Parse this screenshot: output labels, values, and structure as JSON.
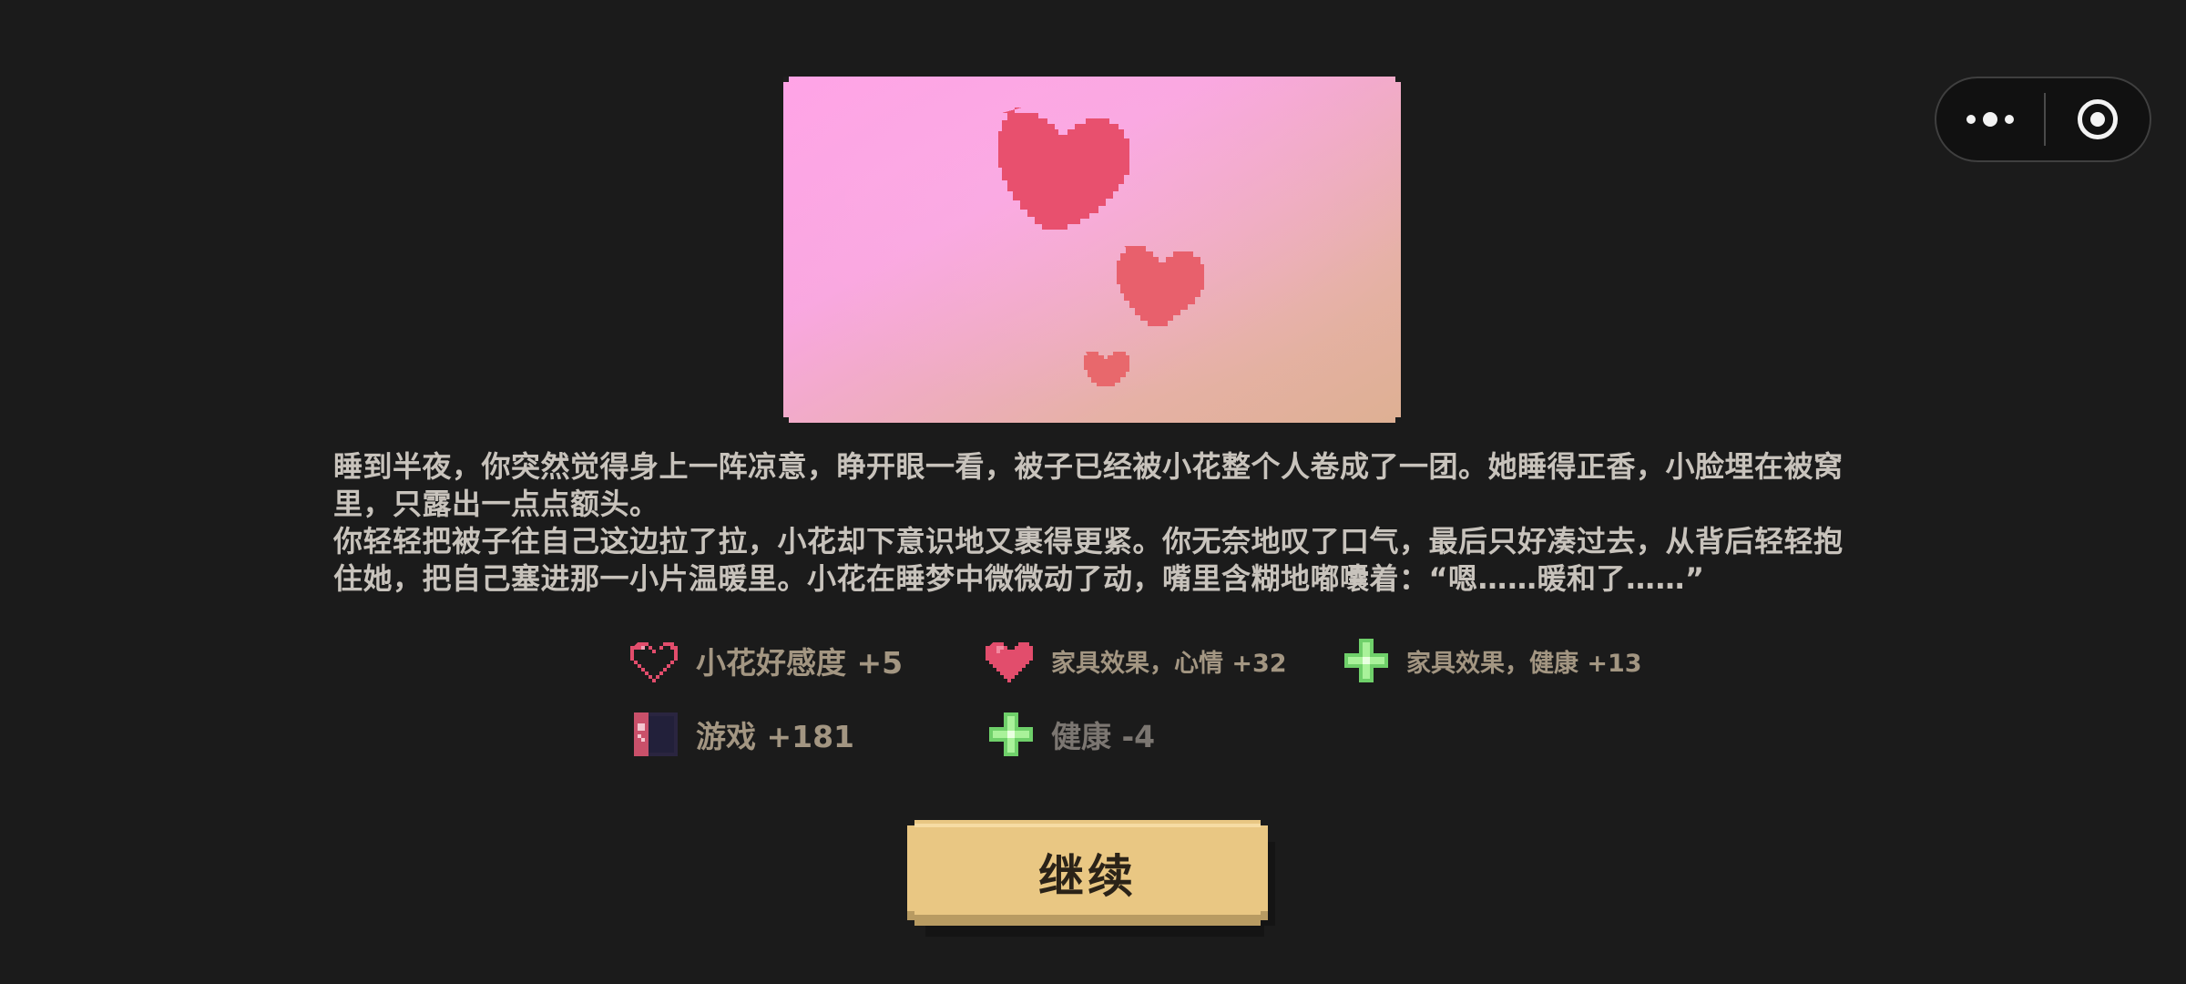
{
  "capsule": {
    "more_icon": "more-dots-icon",
    "close_icon": "target-close-icon"
  },
  "illustration": {
    "icon": "floating-hearts-illustration",
    "colors": {
      "bg_top": "#ffa3e6",
      "bg_bottom": "#dfb197",
      "heart": "#e8506e"
    }
  },
  "story": {
    "paragraph1": "睡到半夜，你突然觉得身上一阵凉意，睁开眼一看，被子已经被小花整个人卷成了一团。她睡得正香，小脸埋在被窝里，只露出一点点额头。",
    "paragraph2": "你轻轻把被子往自己这边拉了拉，小花却下意识地又裹得更紧。你无奈地叹了口气，最后只好凑过去，从背后轻轻抱住她，把自己塞进那一小片温暖里。小花在睡梦中微微动了动，嘴里含糊地嘟囔着：“嗯……暖和了……”"
  },
  "effects": [
    {
      "icon": "heart-outline-icon",
      "text": "小花好感度 +5"
    },
    {
      "icon": "heart-filled-icon",
      "text": "家具效果，心情 +32"
    },
    {
      "icon": "health-cross-icon",
      "text": "家具效果，健康 +13"
    },
    {
      "icon": "game-console-icon",
      "text": "游戏 +181"
    },
    {
      "icon": "health-cross-icon",
      "text": "健康 -4"
    }
  ],
  "continue_button": {
    "label": "继续"
  },
  "colors": {
    "background": "#1b1b1b",
    "effect_text": "#a39682",
    "effect_negative_text": "#7b7671",
    "button_fill": "#e9c783",
    "button_shadow": "#b89b62"
  }
}
